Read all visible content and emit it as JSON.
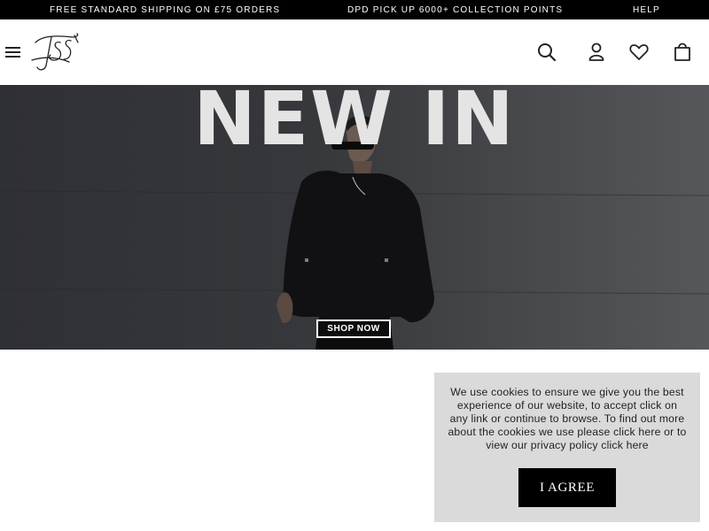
{
  "announcement_bar": {
    "shipping": "FREE STANDARD SHIPPING ON £75 ORDERS",
    "pickup": "DPD PICK UP 6000+ COLLECTION POINTS",
    "help": "HELP"
  },
  "header": {
    "menu_icon": "hamburger-icon",
    "logo_icon": "siksilk-monogram-logo",
    "icons": [
      "search-icon",
      "account-icon",
      "wishlist-heart-icon",
      "bag-icon"
    ]
  },
  "hero": {
    "title": "NEW IN",
    "cta_label": "SHOP NOW"
  },
  "cookie_banner": {
    "message": "We use cookies to ensure we give you the best experience of our website, to accept click on any link or continue to browse. To find out more about the cookies we use please click here or to view our privacy policy click here",
    "accept_label": "I AGREE"
  },
  "colors": {
    "announcement_bg": "#000000",
    "cookie_bg": "#dadada",
    "button_bg": "#000000"
  }
}
